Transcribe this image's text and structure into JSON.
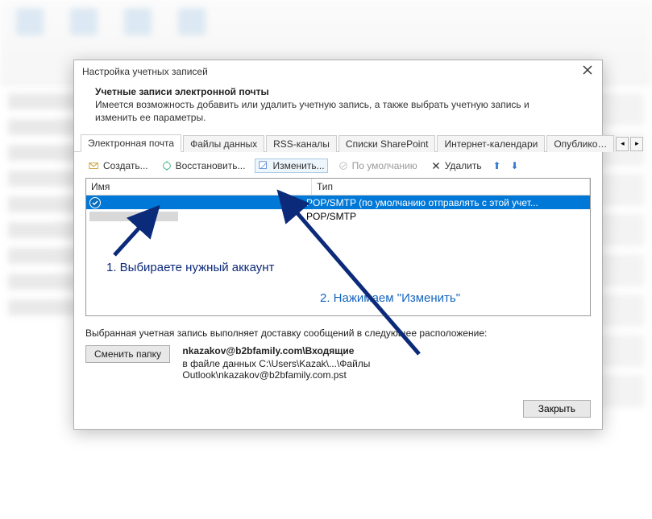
{
  "dialog": {
    "title": "Настройка учетных записей",
    "heading": "Учетные записи электронной почты",
    "description": "Имеется возможность добавить или удалить учетную запись, а также выбрать учетную запись и изменить ее параметры."
  },
  "tabs": [
    {
      "label": "Электронная почта",
      "active": true
    },
    {
      "label": "Файлы данных",
      "active": false
    },
    {
      "label": "RSS-каналы",
      "active": false
    },
    {
      "label": "Списки SharePoint",
      "active": false
    },
    {
      "label": "Интернет-календари",
      "active": false
    },
    {
      "label": "Опублико…",
      "active": false
    }
  ],
  "toolbar": {
    "create": "Создать...",
    "repair": "Восстановить...",
    "change": "Изменить...",
    "default": "По умолчанию",
    "delete": "Удалить"
  },
  "columns": {
    "name": "Имя",
    "type": "Тип"
  },
  "rows": [
    {
      "name": "",
      "type": "POP/SMTP (по умолчанию отправлять с этой учет...",
      "selected": true,
      "default": true
    },
    {
      "name": "",
      "type": "POP/SMTP",
      "selected": false,
      "default": false
    }
  ],
  "annotations": {
    "step1": "1. Выбираете нужный аккаунт",
    "step2": "2. Нажимаем \"Изменить\""
  },
  "delivery": {
    "intro": "Выбранная учетная запись выполняет доставку сообщений в следующее расположение:",
    "change_btn": "Сменить папку",
    "location": "nkazakov@b2bfamily.com\\Входящие",
    "path": "в файле данных C:\\Users\\Kazak\\...\\Файлы Outlook\\nkazakov@b2bfamily.com.pst"
  },
  "footer": {
    "close": "Закрыть"
  }
}
